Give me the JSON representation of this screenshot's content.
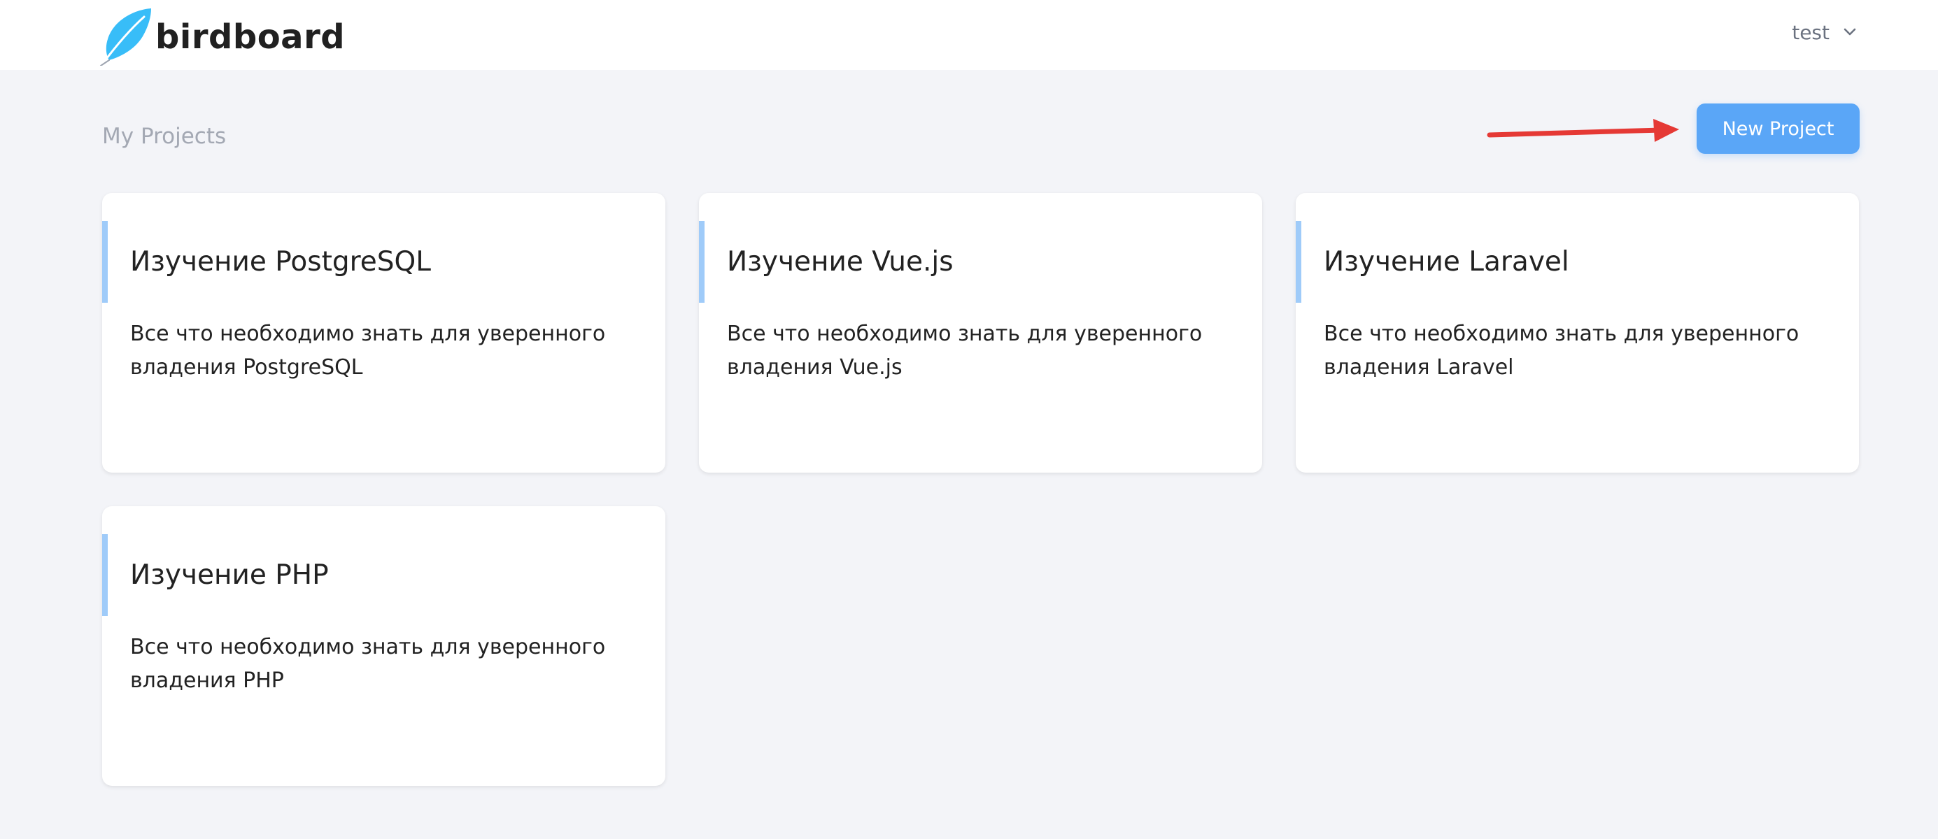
{
  "app": {
    "brand": "birdboard",
    "user_name": "test"
  },
  "page": {
    "section_title": "My Projects",
    "new_project_label": "New Project"
  },
  "projects": [
    {
      "title": "Изучение PostgreSQL",
      "description": "Все что необходимо знать для уверенного владения PostgreSQL"
    },
    {
      "title": "Изучение Vue.js",
      "description": "Все что необходимо знать для уверенного владения Vue.js"
    },
    {
      "title": "Изучение Laravel",
      "description": "Все что необходимо знать для уверенного владения Laravel"
    },
    {
      "title": "Изучение PHP",
      "description": "Все что необходимо знать для уверенного владения PHP"
    }
  ],
  "colors": {
    "page_background": "#f3f4f8",
    "button_primary": "#5aa6f7",
    "card_accent": "#9fcbf9",
    "logo_feather": "#38bdf8",
    "annotation_arrow": "#e53935"
  },
  "icons": {
    "logo": "feather-icon",
    "user_menu": "chevron-down-icon",
    "annotation": "arrow-right-icon"
  }
}
